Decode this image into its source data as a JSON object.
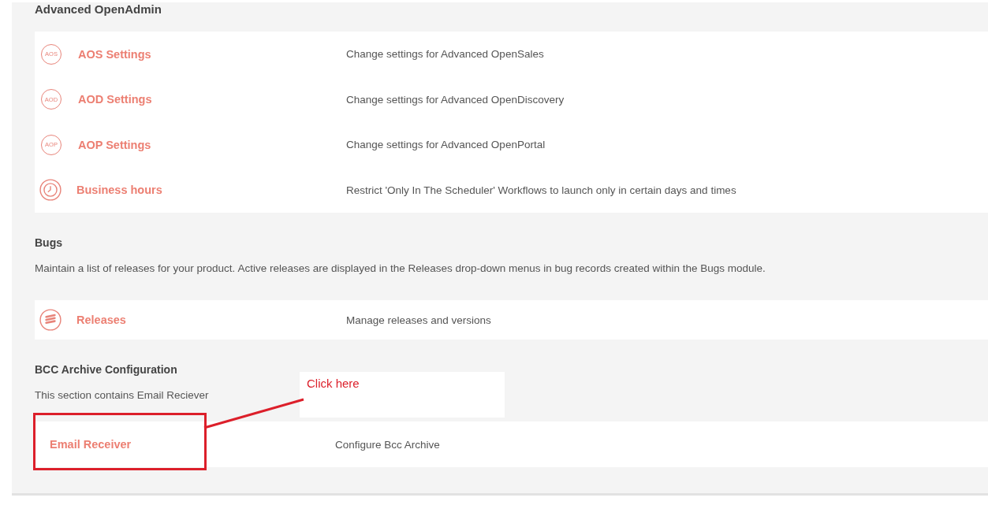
{
  "sections": [
    {
      "title": "Advanced OpenAdmin",
      "rows": [
        {
          "kind": "badge",
          "icon_label": "AOS",
          "link": "AOS Settings",
          "description": "Change settings for Advanced OpenSales"
        },
        {
          "kind": "badge",
          "icon_label": "AOD",
          "link": "AOD Settings",
          "description": "Change settings for Advanced OpenDiscovery"
        },
        {
          "kind": "badge",
          "icon_label": "AOP",
          "link": "AOP Settings",
          "description": "Change settings for Advanced OpenPortal"
        },
        {
          "kind": "clock",
          "link": "Business hours",
          "description": "Restrict 'Only In The Scheduler' Workflows to launch only in certain days and times"
        }
      ]
    },
    {
      "title": "Bugs",
      "description": "Maintain a list of releases for your product. Active releases are displayed in the Releases drop-down menus in bug records created within the Bugs module.",
      "rows": [
        {
          "kind": "layers",
          "link": "Releases",
          "description": "Manage releases and versions"
        }
      ]
    },
    {
      "title": "BCC Archive Configuration",
      "description": "This section contains Email Reciever",
      "rows": [
        {
          "kind": "plain",
          "link": "Email Receiver",
          "description": "Configure Bcc Archive",
          "highlighted": true
        }
      ]
    }
  ],
  "annotation": {
    "text": "Click here"
  }
}
